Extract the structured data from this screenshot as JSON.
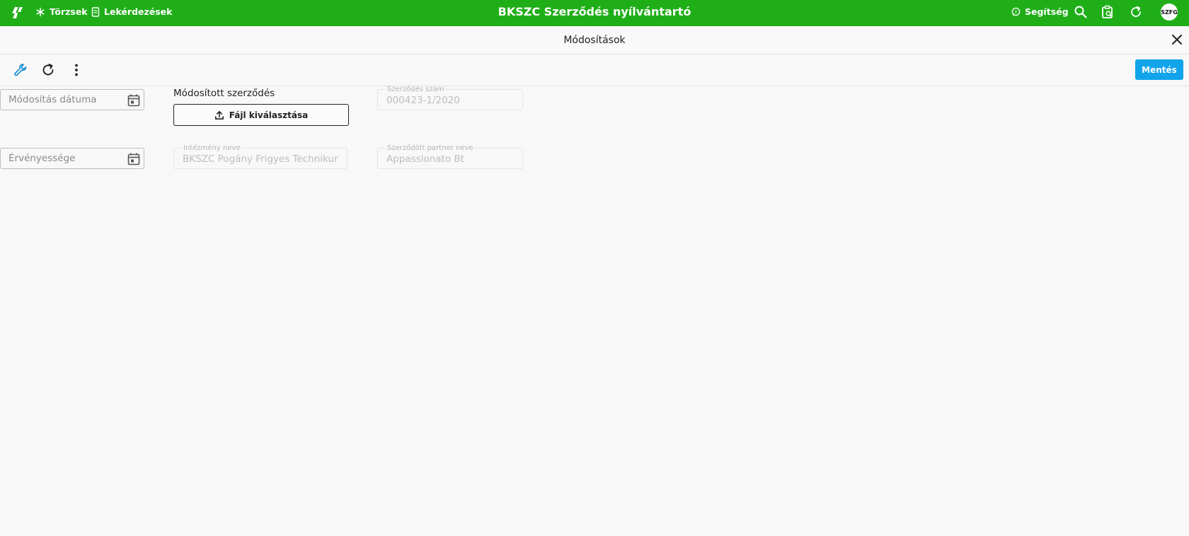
{
  "topbar": {
    "title": "BKSZC Szerződés nyílvántartó",
    "nav": [
      {
        "label": "Törzsek",
        "icon": "asterisk-icon"
      },
      {
        "label": "Lekérdezések",
        "icon": "document-icon"
      }
    ],
    "help_label": "Segítség",
    "avatar_initials": "SZFG",
    "brand_color": "#20ae18"
  },
  "dialog": {
    "title": "Módosítások",
    "save_label": "Mentés",
    "save_color": "#12a4ea"
  },
  "form": {
    "modification_date": {
      "placeholder": "Módosítás dátuma",
      "value": ""
    },
    "validity": {
      "placeholder": "Érvényessége",
      "value": ""
    },
    "modified_contract": {
      "label": "Módosított szerződés",
      "button_label": "Fájl kiválasztása"
    },
    "contract_number": {
      "label": "Szerződés szám",
      "value": "000423-1/2020"
    },
    "institution_name": {
      "label": "Intézmény neve",
      "value": "BKSZC Pogány Frigyes Technikum"
    },
    "partner_name": {
      "label": "Szerződött partner neve",
      "value": "Appassionato Bt"
    }
  }
}
